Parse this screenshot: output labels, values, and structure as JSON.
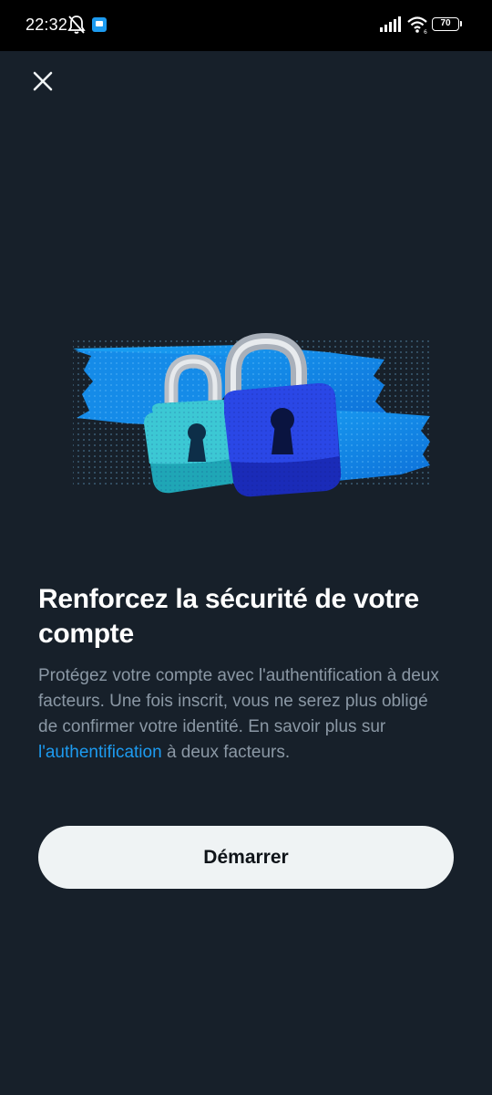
{
  "status_bar": {
    "time": "22:32",
    "battery": "70",
    "icons": [
      "mute-bell-icon",
      "app-notification-icon",
      "signal-icon",
      "wifi-icon",
      "battery-icon"
    ]
  },
  "header": {
    "close_icon": "close-icon"
  },
  "illustration": {
    "icon": "padlocks-illustration",
    "colors": {
      "tape": "#1a8fe6",
      "lock_teal": "#2bb7c4",
      "lock_blue": "#1d35d8",
      "shackle": "#c9cdd2"
    }
  },
  "content": {
    "title": "Renforcez la sécurité de votre compte",
    "description_part1": "Protégez votre compte avec l'authentification à deux facteurs. Une fois inscrit, vous ne serez plus obligé de confirmer votre identité. En savoir plus sur ",
    "link_text": "l'authentification",
    "description_part2": " à deux facteurs."
  },
  "actions": {
    "start_label": "Démarrer"
  },
  "colors": {
    "background": "#17202a",
    "link": "#1d9bf0",
    "secondary_text": "#8b98a5",
    "button_bg": "#eff3f4"
  }
}
